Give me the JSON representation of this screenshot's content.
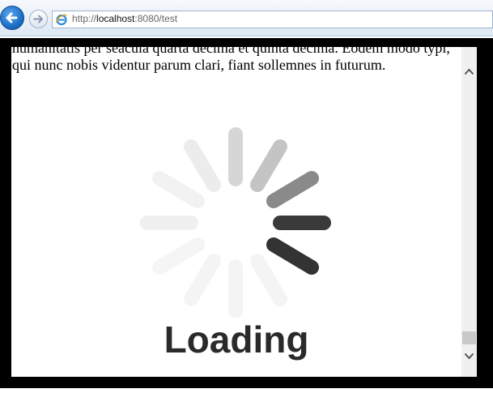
{
  "address_bar": {
    "url_prefix": "http://",
    "url_host": "localhost",
    "url_rest": ":8080/test"
  },
  "content": {
    "paragraph_line1": "humanitatis per seacula quarta decima et quinta decima. Eodem modo typi,",
    "paragraph_line2": "qui nunc nobis videntur parum clari, fiant sollemnes in futurum."
  },
  "loading": {
    "label": "Loading"
  },
  "icons": {
    "back": "back-arrow-icon",
    "forward": "forward-arrow-icon",
    "browser": "internet-explorer-icon",
    "spinner": "loading-spinner-icon"
  },
  "colors": {
    "back_button": "#1d6fc8",
    "spinner_dark": "#333333",
    "spinner_light": "#f5f5f5"
  }
}
